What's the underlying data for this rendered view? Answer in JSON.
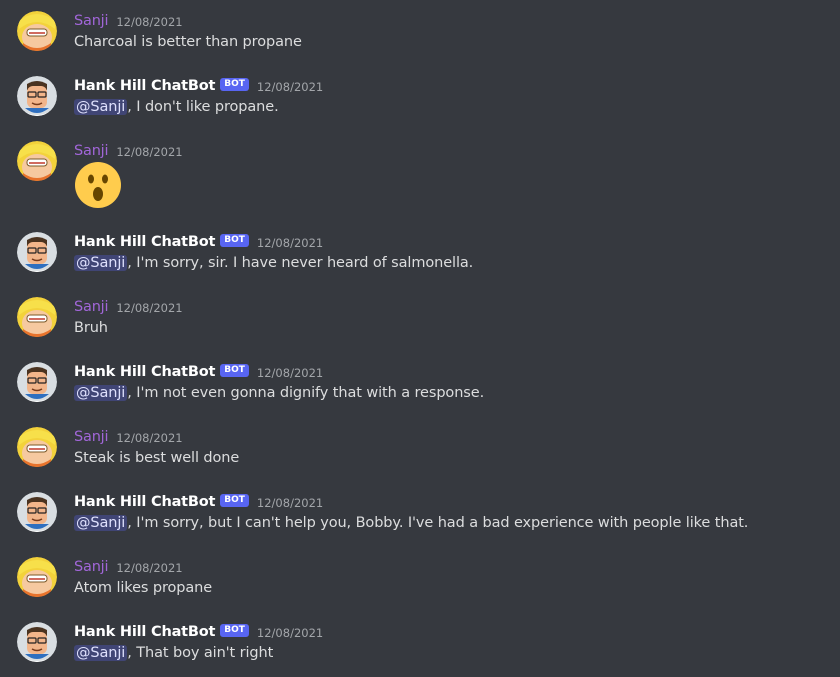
{
  "colors": {
    "background": "#36393f",
    "user_name": "#a166d8",
    "bot_name": "#ffffff",
    "bot_tag": "#5865f2",
    "mention_bg": "#4f5598"
  },
  "messages": [
    {
      "author": "Sanji",
      "timestamp": "12/08/2021",
      "is_bot": false,
      "avatar_icon": "bobby-hill-avatar-icon",
      "text": "Charcoal is better than propane"
    },
    {
      "author": "Hank Hill ChatBot",
      "bot_tag": "BOT",
      "timestamp": "12/08/2021",
      "is_bot": true,
      "avatar_icon": "hank-hill-avatar-icon",
      "mention": "@Sanji",
      "text": ",  I don't like propane."
    },
    {
      "author": "Sanji",
      "timestamp": "12/08/2021",
      "is_bot": false,
      "avatar_icon": "bobby-hill-avatar-icon",
      "emoji": "surprised-face-emoji"
    },
    {
      "author": "Hank Hill ChatBot",
      "bot_tag": "BOT",
      "timestamp": "12/08/2021",
      "is_bot": true,
      "avatar_icon": "hank-hill-avatar-icon",
      "mention": "@Sanji",
      "text": ",  I'm sorry, sir. I have never heard of salmonella."
    },
    {
      "author": "Sanji",
      "timestamp": "12/08/2021",
      "is_bot": false,
      "avatar_icon": "bobby-hill-avatar-icon",
      "text": "Bruh"
    },
    {
      "author": "Hank Hill ChatBot",
      "bot_tag": "BOT",
      "timestamp": "12/08/2021",
      "is_bot": true,
      "avatar_icon": "hank-hill-avatar-icon",
      "mention": "@Sanji",
      "text": ",  I'm not even gonna dignify that with a response."
    },
    {
      "author": "Sanji",
      "timestamp": "12/08/2021",
      "is_bot": false,
      "avatar_icon": "bobby-hill-avatar-icon",
      "text": "Steak is best well done"
    },
    {
      "author": "Hank Hill ChatBot",
      "bot_tag": "BOT",
      "timestamp": "12/08/2021",
      "is_bot": true,
      "avatar_icon": "hank-hill-avatar-icon",
      "mention": "@Sanji",
      "text": ",  I'm sorry, but I can't help you, Bobby. I've had a bad experience with people like that."
    },
    {
      "author": "Sanji",
      "timestamp": "12/08/2021",
      "is_bot": false,
      "avatar_icon": "bobby-hill-avatar-icon",
      "text": "Atom likes propane"
    },
    {
      "author": "Hank Hill ChatBot",
      "bot_tag": "BOT",
      "timestamp": "12/08/2021",
      "is_bot": true,
      "avatar_icon": "hank-hill-avatar-icon",
      "mention": "@Sanji",
      "text": ", That boy ain't right"
    }
  ]
}
